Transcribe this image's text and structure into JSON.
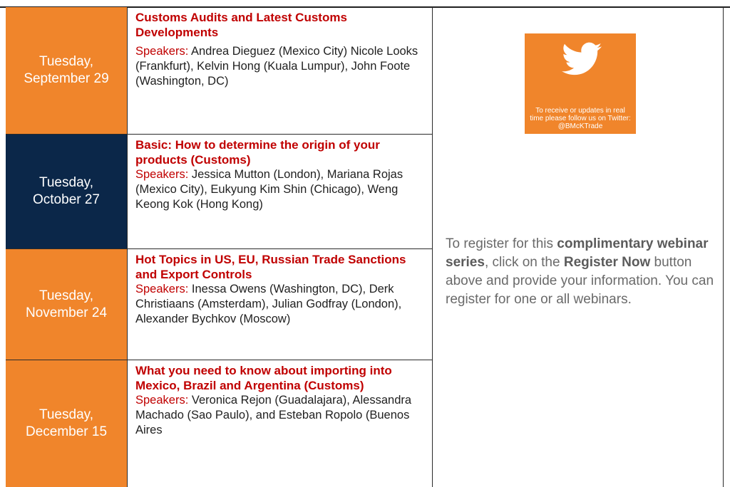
{
  "sessions": [
    {
      "date_line1": "Tuesday,",
      "date_line2": "September 29",
      "title": "Customs Audits and Latest Customs Developments",
      "speakers_label": "Speakers:",
      "speakers_text": " Andrea Dieguez (Mexico City) Nicole Looks (Frankfurt), Kelvin Hong (Kuala Lumpur), John Foote (Washington, DC)"
    },
    {
      "date_line1": "Tuesday,",
      "date_line2": "October 27",
      "title": "Basic: How to determine the origin of your products (Customs)",
      "speakers_label": "Speakers:",
      "speakers_text": " Jessica Mutton (London), Mariana Rojas (Mexico City), Eukyung Kim Shin (Chicago), Weng Keong Kok (Hong Kong)"
    },
    {
      "date_line1": "Tuesday,",
      "date_line2": "November 24",
      "title": "Hot Topics in US, EU, Russian Trade Sanctions and Export Controls",
      "speakers_label": "Speakers:",
      "speakers_text": "  Inessa Owens (Washington, DC), Derk Christiaans (Amsterdam), Julian Godfray (London), Alexander Bychkov (Moscow)"
    },
    {
      "date_line1": "Tuesday,",
      "date_line2": "December 15",
      "title": "What you need to know about importing into Mexico, Brazil and Argentina (Customs)",
      "speakers_label": "Speakers:",
      "speakers_text": " Veronica Rejon (Guadalajara), Alessandra Machado (Sao Paulo), and Esteban Ropolo (Buenos Aires"
    }
  ],
  "twitter": {
    "icon": "twitter-bird-icon",
    "text": "To receive or updates in real time please follow us on Twitter: @BMcKTrade"
  },
  "register": {
    "part1": "To register for this ",
    "bold1": "complimentary webinar series",
    "part2": ", click on the ",
    "bold2": "Register Now",
    "part3": " button above and provide your information. You can register for one or all webinars."
  },
  "colors": {
    "orange": "#f0852b",
    "navy": "#0b2749",
    "title_red": "#c00000"
  }
}
